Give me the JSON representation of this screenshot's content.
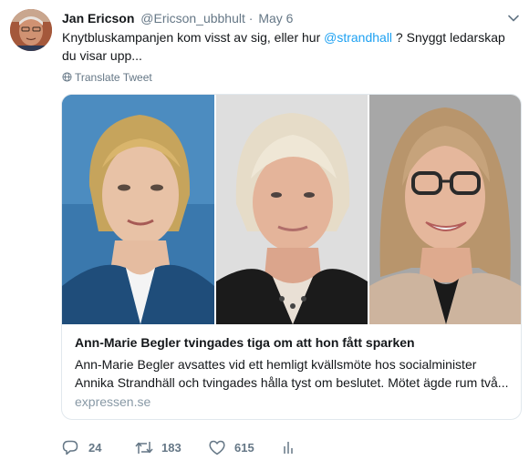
{
  "author": {
    "name": "Jan Ericson",
    "handle": "@Ericson_ubbhult",
    "separator": "·",
    "date": "May 6"
  },
  "tweet": {
    "text_before": "Knytbluskampanjen kom visst av sig, eller hur ",
    "mention": "@strandhall",
    "text_after": " ? Snyggt ledarskap du visar upp..."
  },
  "translate_label": "Translate Tweet",
  "card": {
    "title": "Ann-Marie Begler tvingades tiga om att hon fått sparken",
    "description_line1": "Ann-Marie Begler avsattes vid ett hemligt kvällsmöte hos socialminister",
    "description_line2": "Annika Strandhäll och tvingades hålla tyst om beslutet. Mötet ägde rum två...",
    "domain": "expressen.se"
  },
  "actions": {
    "replies": "24",
    "retweets": "183",
    "likes": "615"
  },
  "colors": {
    "accent": "#1da1f2",
    "muted": "#657786",
    "border": "#e1e8ed",
    "text": "#14171a"
  },
  "icons": [
    "chevron-down-icon",
    "globe-icon",
    "reply-icon",
    "retweet-icon",
    "heart-icon",
    "analytics-icon"
  ]
}
